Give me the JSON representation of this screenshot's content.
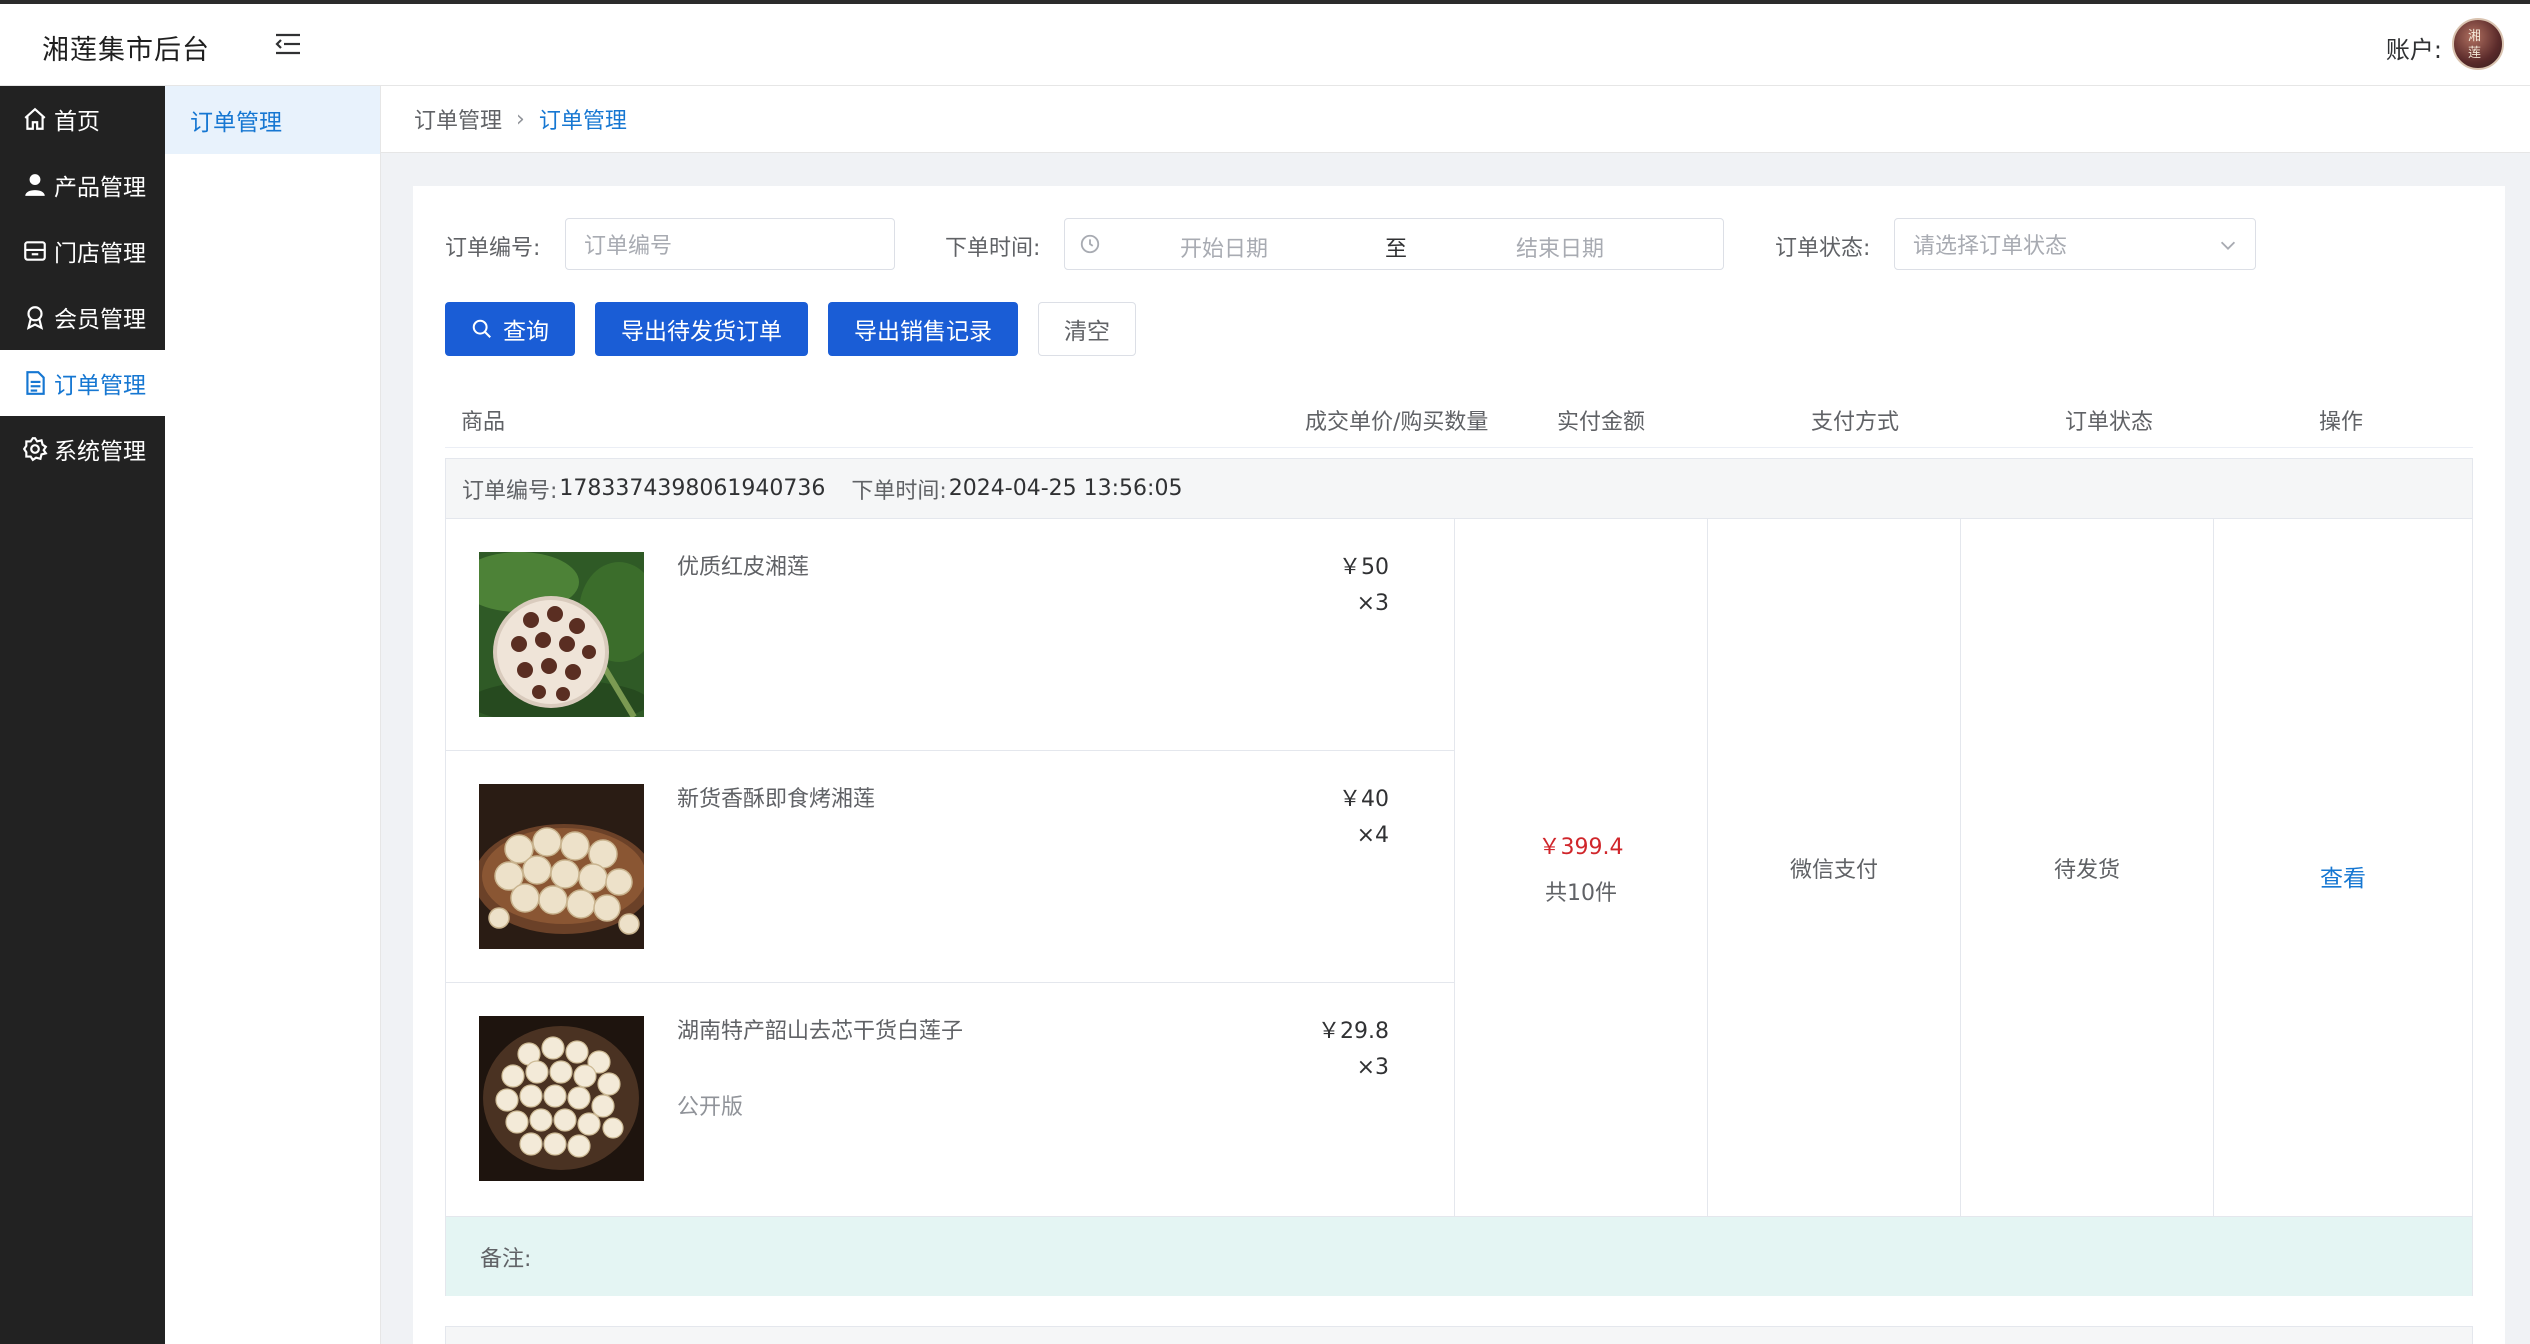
{
  "app": {
    "title": "湘莲集市后台",
    "account_label": "账户:",
    "avatar_text": "湘莲"
  },
  "sidebar": {
    "items": [
      {
        "label": "首页",
        "icon": "home-icon"
      },
      {
        "label": "产品管理",
        "icon": "user-icon"
      },
      {
        "label": "门店管理",
        "icon": "store-icon"
      },
      {
        "label": "会员管理",
        "icon": "medal-icon"
      },
      {
        "label": "订单管理",
        "icon": "document-icon",
        "active": true
      },
      {
        "label": "系统管理",
        "icon": "gear-icon"
      }
    ]
  },
  "submenu": {
    "items": [
      {
        "label": "订单管理",
        "active": true
      }
    ]
  },
  "breadcrumb": {
    "items": [
      "订单管理",
      "订单管理"
    ]
  },
  "filters": {
    "order_no_label": "订单编号:",
    "order_no_placeholder": "订单编号",
    "time_label": "下单时间:",
    "start_placeholder": "开始日期",
    "range_sep": "至",
    "end_placeholder": "结束日期",
    "status_label": "订单状态:",
    "status_placeholder": "请选择订单状态"
  },
  "buttons": {
    "query": "查询",
    "export_pending": "导出待发货订单",
    "export_sales": "导出销售记录",
    "clear": "清空"
  },
  "table": {
    "headers": [
      "商品",
      "成交单价/购买数量",
      "实付金额",
      "支付方式",
      "订单状态",
      "操作"
    ]
  },
  "order": {
    "no_label": "订单编号:",
    "no": "1783374398061940736",
    "time_label": "下单时间:",
    "time": "2024-04-25 13:56:05",
    "items": [
      {
        "name": "优质红皮湘莲",
        "spec": "",
        "price": "￥50",
        "qty": "×3"
      },
      {
        "name": "新货香酥即食烤湘莲",
        "spec": "",
        "price": "￥40",
        "qty": "×4"
      },
      {
        "name": "湖南特产韶山去芯干货白莲子",
        "spec": "公开版",
        "price": "￥29.8",
        "qty": "×3"
      }
    ],
    "amount": "￥399.4",
    "total_count": "共10件",
    "payment": "微信支付",
    "status": "待发货",
    "action": "查看",
    "remark_label": "备注:"
  },
  "colors": {
    "primary": "#1a5dd6",
    "link": "#1677d2",
    "sidebar_bg": "#222222",
    "amount": "#d0262b",
    "remark_bg": "#e4f5f3"
  }
}
